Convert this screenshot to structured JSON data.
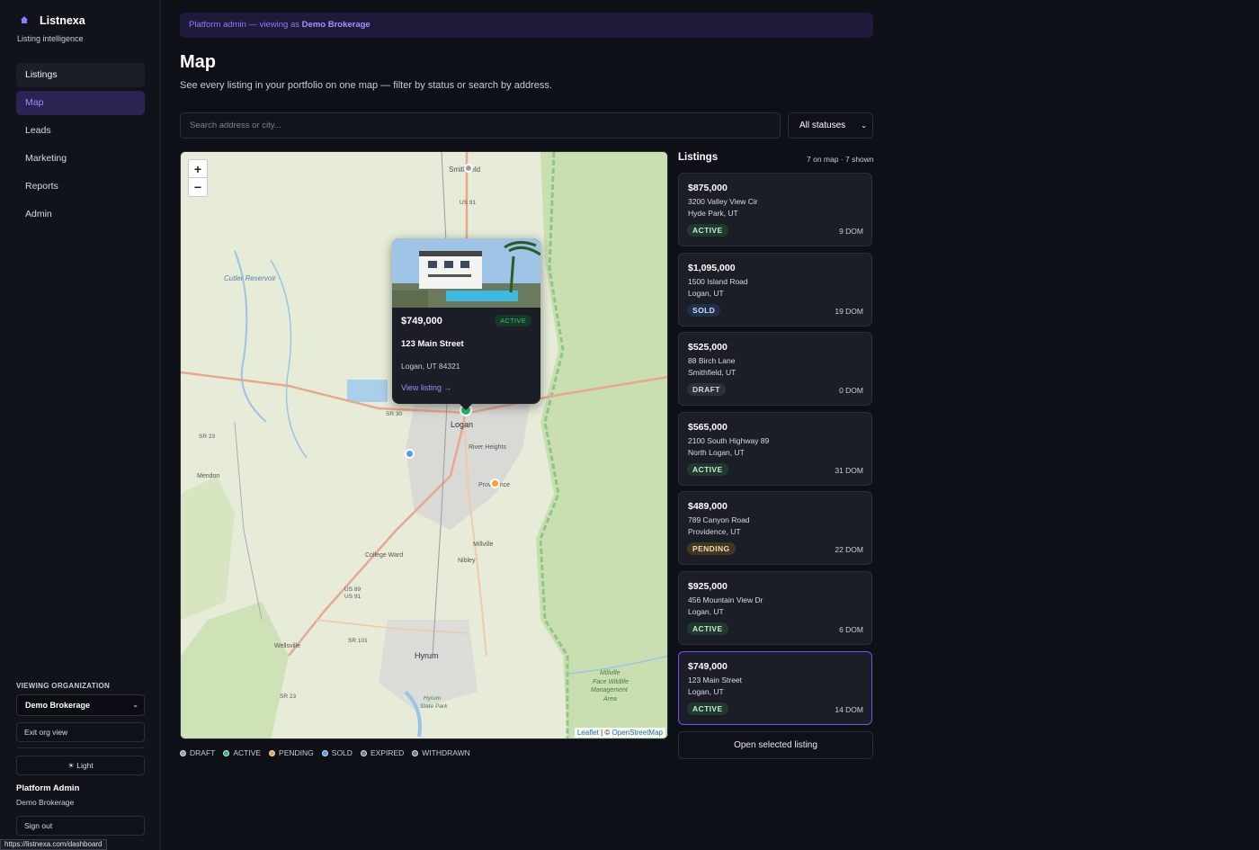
{
  "app": {
    "name": "Listnexa",
    "tagline": "Listing intelligence"
  },
  "nav": {
    "items": [
      {
        "label": "Listings"
      },
      {
        "label": "Map"
      },
      {
        "label": "Leads"
      },
      {
        "label": "Marketing"
      },
      {
        "label": "Reports"
      },
      {
        "label": "Admin"
      }
    ]
  },
  "sidebar": {
    "org_label": "VIEWING ORGANIZATION",
    "org_selected": "Demo Brokerage",
    "exit_label": "Exit org view",
    "theme_label": "☀ Light",
    "user_name": "Platform Admin",
    "user_org": "Demo Brokerage",
    "signout_label": "Sign out"
  },
  "status_url": "https://listnexa.com/dashboard",
  "banner": {
    "prefix": "Platform admin — viewing as ",
    "org": "Demo Brokerage"
  },
  "page": {
    "title": "Map",
    "description": "See every listing in your portfolio on one map — filter by status or search by address."
  },
  "search": {
    "placeholder": "Search address or city...",
    "value": ""
  },
  "status_filter": {
    "selected": "All statuses"
  },
  "map": {
    "zoom_in": "+",
    "zoom_out": "−",
    "attribution_leaflet": "Leaflet",
    "attribution_sep": " | © ",
    "attribution_osm": "OpenStreetMap",
    "place_labels": [
      "Smithfield",
      "US 91",
      "Cutler Reservoir",
      "SR 30",
      "SR 23",
      "Logan",
      "River Heights",
      "Mendon",
      "Providence",
      "College Ward",
      "Millville",
      "Nibley",
      "US 89",
      "US 91",
      "SR 101",
      "Wellsville",
      "Hyrum",
      "SR 23",
      "Millville Face Wildlife Management Area",
      "Hyrum State Park"
    ],
    "popup": {
      "price": "$749,000",
      "status": "ACTIVE",
      "street": "123 Main Street",
      "city": "Logan, UT 84321",
      "link": "View listing →"
    }
  },
  "legend": [
    {
      "label": "DRAFT",
      "color": "#9aa0ab"
    },
    {
      "label": "ACTIVE",
      "color": "#2bb673"
    },
    {
      "label": "PENDING",
      "color": "#f2a531"
    },
    {
      "label": "SOLD",
      "color": "#4d9df0"
    },
    {
      "label": "EXPIRED",
      "color": "#777c87"
    },
    {
      "label": "WITHDRAWN",
      "color": "#777c87"
    }
  ],
  "listings_panel": {
    "title": "Listings",
    "count": "7 on map · 7 shown",
    "open_button": "Open selected listing",
    "cards": [
      {
        "price": "$875,000",
        "street": "3200 Valley View Cir",
        "city": "Hyde Park, UT",
        "status": "ACTIVE",
        "dom": "9 DOM"
      },
      {
        "price": "$1,095,000",
        "street": "1500 Island Road",
        "city": "Logan, UT",
        "status": "SOLD",
        "dom": "19 DOM"
      },
      {
        "price": "$525,000",
        "street": "88 Birch Lane",
        "city": "Smithfield, UT",
        "status": "DRAFT",
        "dom": "0 DOM"
      },
      {
        "price": "$565,000",
        "street": "2100 South Highway 89",
        "city": "North Logan, UT",
        "status": "ACTIVE",
        "dom": "31 DOM"
      },
      {
        "price": "$489,000",
        "street": "789 Canyon Road",
        "city": "Providence, UT",
        "status": "PENDING",
        "dom": "22 DOM"
      },
      {
        "price": "$925,000",
        "street": "456 Mountain View Dr",
        "city": "Logan, UT",
        "status": "ACTIVE",
        "dom": "6 DOM"
      },
      {
        "price": "$749,000",
        "street": "123 Main Street",
        "city": "Logan, UT",
        "status": "ACTIVE",
        "dom": "14 DOM"
      }
    ]
  }
}
